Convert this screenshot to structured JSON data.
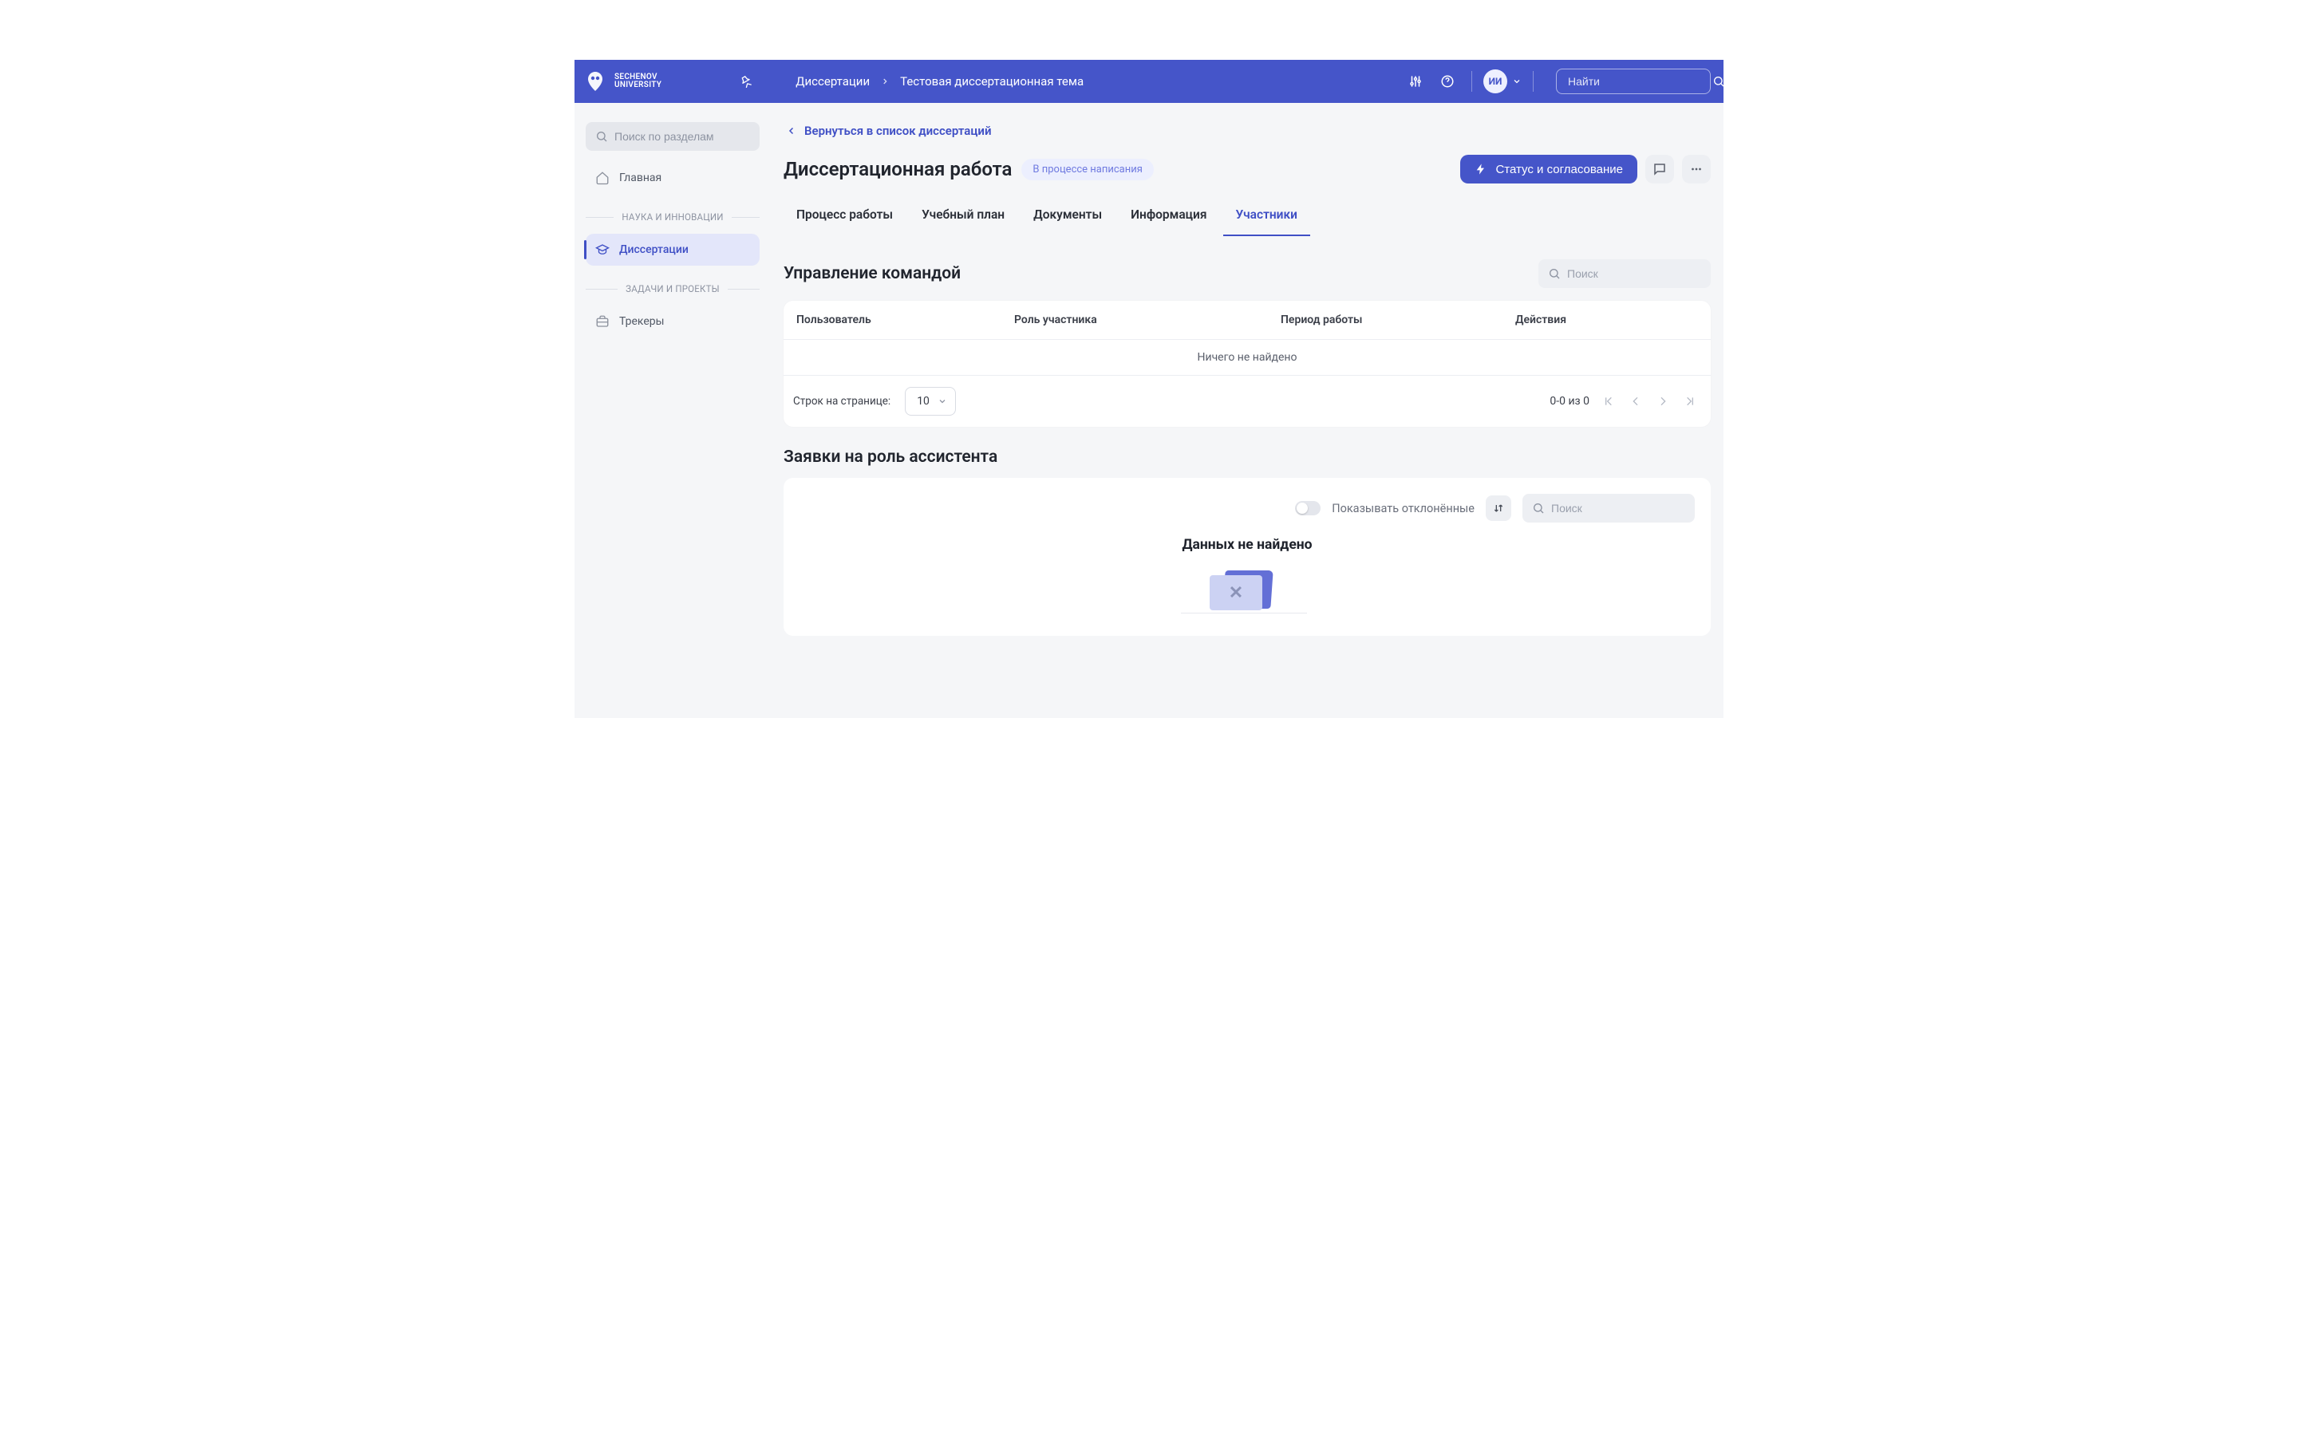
{
  "brand": {
    "line1": "SECHENOV",
    "line2": "UNIVERSITY"
  },
  "topbar": {
    "crumb1": "Диссертации",
    "crumb2": "Тестовая диссертационная тема",
    "avatar_initials": "ИИ",
    "search_placeholder": "Найти"
  },
  "sidebar": {
    "search_placeholder": "Поиск по разделам",
    "items": {
      "home": "Главная",
      "dissertations": "Диссертации",
      "trackers": "Трекеры"
    },
    "sections": {
      "science": "НАУКА И ИННОВАЦИИ",
      "tasks": "ЗАДАЧИ И ПРОЕКТЫ"
    }
  },
  "page": {
    "back": "Вернуться в список диссертаций",
    "title": "Диссертационная работа",
    "status_pill": "В процессе написания",
    "actions": {
      "status_button": "Статус и согласование"
    },
    "tabs": {
      "process": "Процесс работы",
      "plan": "Учебный план",
      "docs": "Документы",
      "info": "Информация",
      "members": "Участники"
    }
  },
  "team": {
    "title": "Управление командой",
    "search_placeholder": "Поиск",
    "columns": {
      "user": "Пользователь",
      "role": "Роль участника",
      "period": "Период работы",
      "actions": "Действия"
    },
    "empty": "Ничего не найдено",
    "rows_label": "Строк на странице:",
    "page_size": "10",
    "pager_info": "0-0 из 0"
  },
  "requests": {
    "title": "Заявки на роль ассистента",
    "show_rejected": "Показывать отклонённые",
    "search_placeholder": "Поиск",
    "nodata": "Данных не найдено"
  }
}
